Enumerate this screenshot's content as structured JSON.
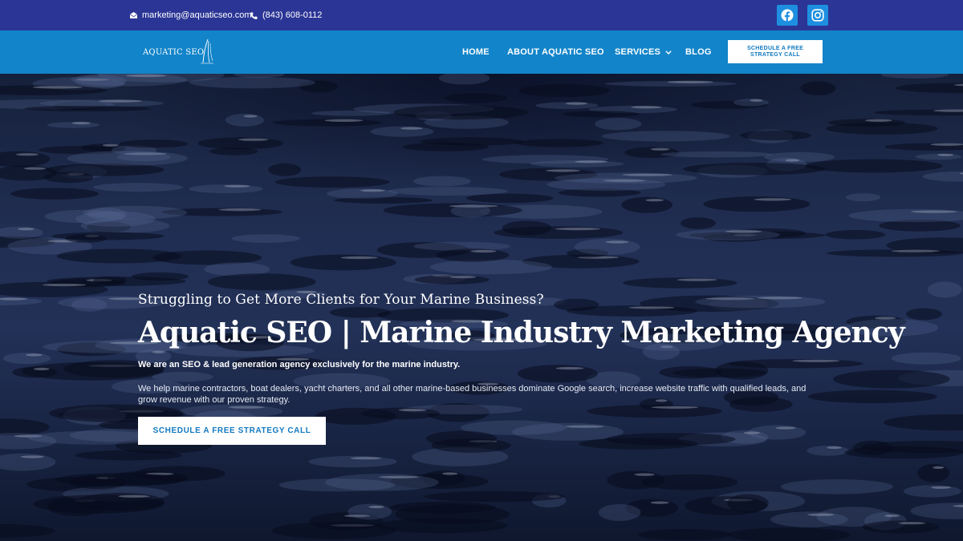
{
  "topbar": {
    "email": "marketing@aquaticseo.com",
    "phone": "(843) 608-0112",
    "icons": [
      "envelope-icon",
      "phone-icon",
      "facebook-icon",
      "instagram-icon"
    ],
    "background": "#2b3595",
    "social_color": "#1e8fe0"
  },
  "nav": {
    "logo_text": "AQUATIC SEO",
    "items": [
      "HOME",
      "ABOUT AQUATIC SEO",
      "SERVICES",
      "BLOG"
    ],
    "cta": "SCHEDULE A FREE STRATEGY CALL",
    "background": "#1284c9",
    "services_icon": "chevron-down-icon"
  },
  "hero": {
    "subtitle": "Struggling to Get More Clients for Your Marine Business?",
    "title": "Aquatic SEO | Marine Industry Marketing Agency",
    "tagline": "We are an SEO & lead generation agency exclusively for the marine industry.",
    "description": "We help marine contractors, boat dealers, yacht charters, and all other marine-based businesses dominate Google search, increase website traffic with qualified leads, and grow revenue with our proven strategy.",
    "cta": "SCHEDULE A FREE STRATEGY CALL",
    "accent": "#1279c0"
  }
}
